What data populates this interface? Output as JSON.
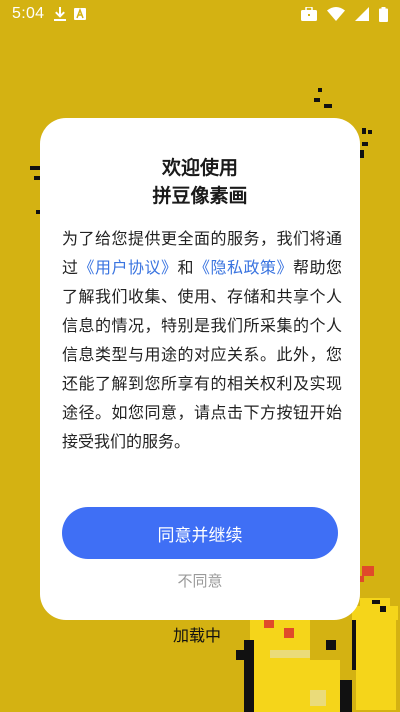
{
  "status_bar": {
    "time": "5:04",
    "left_icons": [
      "download-icon",
      "font-a-icon"
    ],
    "right_icons": [
      "briefcase-icon",
      "wifi-icon",
      "signal-icon",
      "battery-icon"
    ]
  },
  "background": {
    "color": "#d4b212",
    "loading_text": "加载中"
  },
  "dialog": {
    "title_line1": "欢迎使用",
    "title_line2": "拼豆像素画",
    "body": {
      "part1": "为了给您提供更全面的服务，我们将通过",
      "user_agreement_link": "《用户协议》",
      "and": "和",
      "privacy_policy_link": "《隐私政策》",
      "part2": "帮助您了解我们收集、使用、存储和共享个人信息的情况，特别是我们所采集的个人信息类型与用途的对应关系。此外，您还能了解到您所享有的相关权利及实现途径。如您同意，请点击下方按钮开始接受我们的服务。"
    },
    "agree_button": "同意并继续",
    "disagree_button": "不同意"
  },
  "colors": {
    "accent": "#3f6ff5",
    "link": "#3a74e0",
    "background": "#d4b212"
  }
}
